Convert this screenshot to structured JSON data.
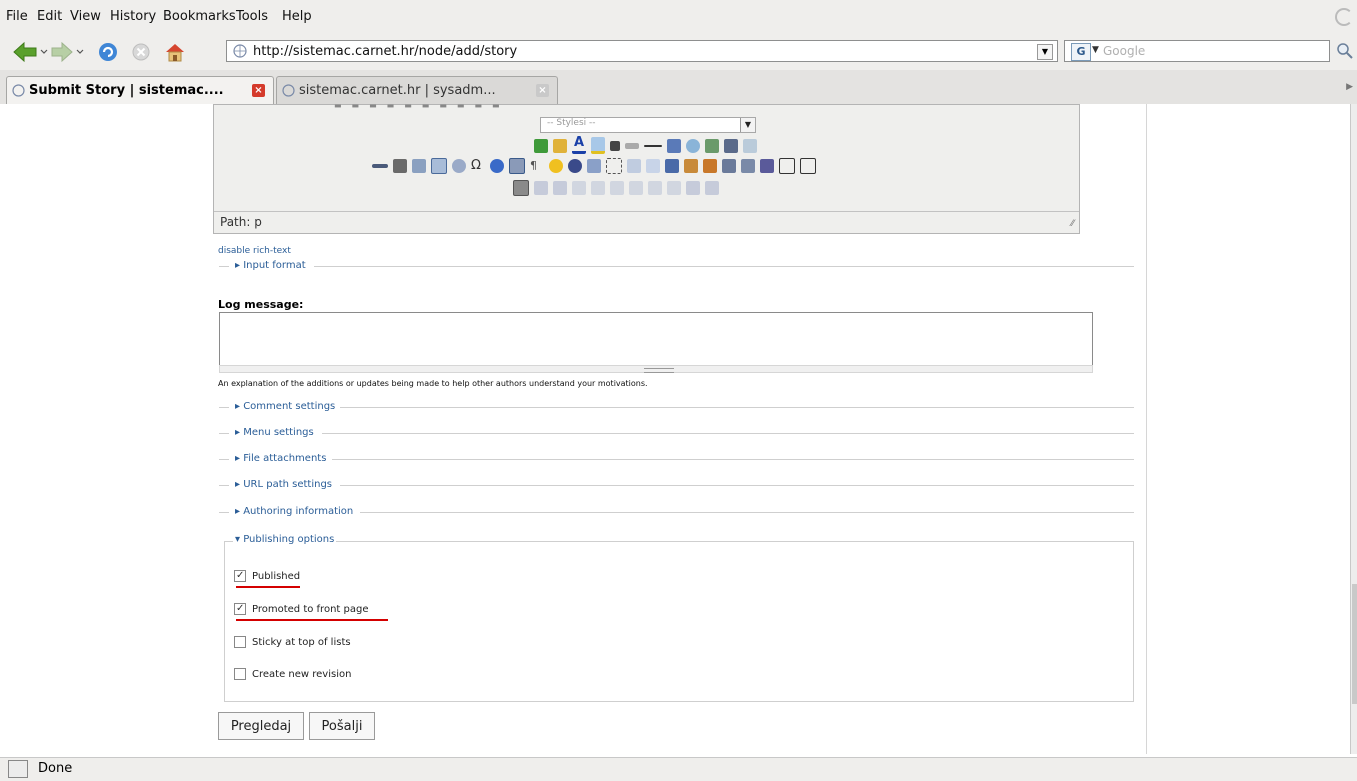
{
  "menu": {
    "file": "File",
    "edit": "Edit",
    "view": "View",
    "history": "History",
    "bookmarks": "Bookmarks",
    "tools": "Tools",
    "help": "Help"
  },
  "nav": {
    "url": "http://sistemac.carnet.hr/node/add/story",
    "search_placeholder": "Google"
  },
  "tabs": [
    {
      "label": "Submit Story | sistemac...."
    },
    {
      "label": "sistemac.carnet.hr | sysadm..."
    }
  ],
  "editor": {
    "styles_placeholder": "-- Stylesi --",
    "path_label": "Path: p",
    "toolbar_icons": [
      "spellcheck-icon",
      "format-icon",
      "font-color-icon",
      "highlight-icon",
      "subscript-icon",
      "html-icon",
      "hr-icon"
    ]
  },
  "links": {
    "disable_rich_text": "disable rich-text",
    "input_format": "Input format"
  },
  "log": {
    "label": "Log message:",
    "value": "",
    "description": "An explanation of the additions or updates being made to help other authors understand your motivations."
  },
  "sections": [
    {
      "label": "Comment settings"
    },
    {
      "label": "Menu settings"
    },
    {
      "label": "File attachments"
    },
    {
      "label": "URL path settings"
    },
    {
      "label": "Authoring information"
    }
  ],
  "publishing": {
    "legend": "Publishing options",
    "options": [
      {
        "label": "Published",
        "checked": true
      },
      {
        "label": "Promoted to front page",
        "checked": true
      },
      {
        "label": "Sticky at top of lists",
        "checked": false
      },
      {
        "label": "Create new revision",
        "checked": false
      }
    ]
  },
  "buttons": {
    "preview": "Pregledaj",
    "submit": "Pošalji"
  },
  "status": {
    "text": "Done"
  },
  "colors": {
    "chrome": "#efeeec",
    "link": "#2a5d97",
    "highlight": "#d40000"
  }
}
